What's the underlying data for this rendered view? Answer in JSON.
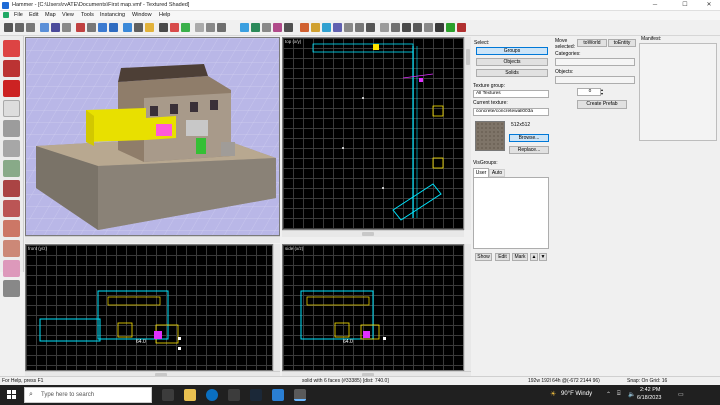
{
  "window": {
    "title": "Hammer - [C:\\Users\\rvATE\\Documents\\First map.vmf - Textured Shaded]",
    "minimize": "─",
    "maximize": "☐",
    "close": "✕"
  },
  "menu": [
    "File",
    "Edit",
    "Map",
    "View",
    "Tools",
    "Instancing",
    "Window",
    "Help"
  ],
  "viewports": {
    "top_label": "top (x/y)",
    "front_label": "front (y/z)",
    "side_label": "side (x/z)",
    "front_dim": "64.0",
    "side_dim": "64.0"
  },
  "panel": {
    "select_label": "Select:",
    "groups": "Groups",
    "objects": "Objects",
    "solids": "Solids",
    "texture_group_label": "Texture group:",
    "texture_group_value": "All Textures",
    "current_texture_label": "Current texture:",
    "current_texture_value": "concrete/concretewall003a",
    "texture_size": "512x512",
    "browse": "Browse...",
    "replace": "Replace...",
    "visgroups_label": "VisGroups:",
    "tab_user": "User",
    "tab_auto": "Auto",
    "show": "Show",
    "edit": "Edit",
    "mark": "Mark"
  },
  "rpanel": {
    "move_selected": "Move selected:",
    "toworld": "toWorld",
    "toentity": "toEntity",
    "categories": "Categories:",
    "objects": "Objects:",
    "counter": "0",
    "create_prefab": "Create Prefab",
    "manifest": "Manifest:"
  },
  "status": {
    "help": "For Help, press F1",
    "selection": "solid with 6 faces (#33385)   [dist: 740.0]",
    "coords": "192w 192l 64h @(-672 2144 96)",
    "snap": "Snap: On Grid: 16"
  },
  "taskbar": {
    "search_placeholder": "Type here to search",
    "weather": "90°F  Windy",
    "time": "2:42 PM",
    "date": "6/18/2023"
  },
  "colors": {
    "grid_line": "#3a3a3a",
    "brush_cyan": "#00e6ff",
    "brush_yellow": "#ffe600",
    "brush_magenta": "#e030ff",
    "sky_3d": "#b8b6e6"
  }
}
